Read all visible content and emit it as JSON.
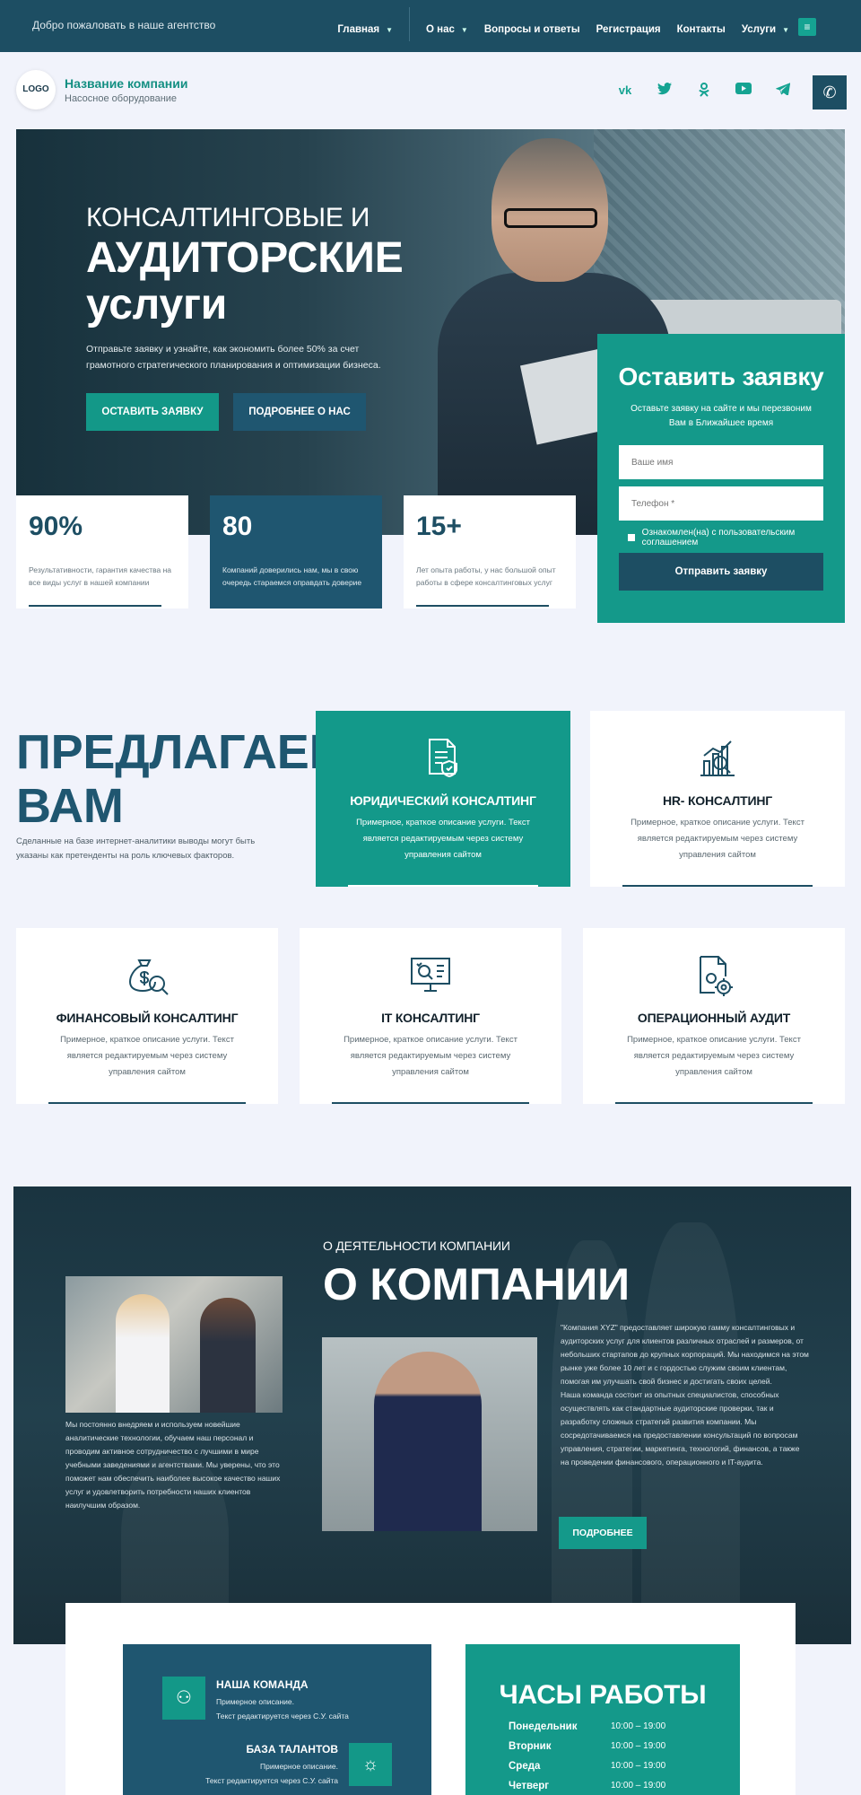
{
  "topbar": {
    "welcome": "Добро пожаловать в наше агентство",
    "nav": [
      {
        "label": "Главная",
        "dropdown": true
      },
      {
        "label": "О нас",
        "dropdown": true
      },
      {
        "label": "Вопросы и ответы",
        "dropdown": false
      },
      {
        "label": "Регистрация",
        "dropdown": false
      },
      {
        "label": "Контакты",
        "dropdown": false
      },
      {
        "label": "Услуги",
        "dropdown": true
      }
    ]
  },
  "header": {
    "logo": "LOGO",
    "company_name": "Название компании",
    "company_sub": "Насосное оборудование",
    "socials": [
      "vk-icon",
      "twitter-icon",
      "odnoklassniki-icon",
      "youtube-icon",
      "telegram-icon"
    ],
    "social_glyphs": [
      "vk",
      "🐦",
      "ꝋ",
      "▶",
      "➤"
    ]
  },
  "hero": {
    "title_line1": "КОНСАЛТИНГОВЫЕ И",
    "title_line2": "АУДИТОРСКИЕ услуги",
    "description": "Отправьте заявку и узнайте, как экономить более 50% за счет грамотного стратегического планирования и оптимизации бизнеса.",
    "btn_order": "ОСТАВИТЬ ЗАЯВКУ",
    "btn_more": "ПОДРОБНЕЕ О НАС"
  },
  "stats": [
    {
      "value": "90%",
      "text": "Результативности, гарантия качества на все виды услуг в нашей компании"
    },
    {
      "value": "80",
      "text": "Компаний доверились нам, мы в свою очередь стараемся оправдать доверие"
    },
    {
      "value": "15+",
      "text": "Лет опыта работы, у нас большой опыт работы в сфере консалтинговых услуг"
    }
  ],
  "form": {
    "title": "Оставить заявку",
    "subtitle": "Оставьте заявку на сайте и мы перезвоним Вам в Ближайшее время",
    "name_placeholder": "Ваше имя",
    "phone_placeholder": "Телефон *",
    "agree": "Ознакомлен(на) с пользовательским соглашением",
    "submit": "Отправить заявку"
  },
  "offer": {
    "title": "ПРЕДЛАГАЕМ ВАМ",
    "description": "Сделанные на базе интернет-аналитики выводы могут быть указаны как претенденты на роль ключевых факторов."
  },
  "services": [
    {
      "name": "ЮРИДИЧЕСКИЙ КОНСАЛТИНГ",
      "desc": "Примерное, краткое описание услуги. Текст является редактируемым через систему управления сайтом",
      "icon": "legal-document-icon"
    },
    {
      "name": "HR- КОНСАЛТИНГ",
      "desc": "Примерное, краткое описание услуги. Текст является редактируемым через систему управления сайтом",
      "icon": "hr-chart-icon"
    },
    {
      "name": "ФИНАНСОВЫЙ КОНСАЛТИНГ",
      "desc": "Примерное, краткое описание услуги. Текст является редактируемым через систему управления сайтом",
      "icon": "money-bag-icon"
    },
    {
      "name": "IT КОНСАЛТИНГ",
      "desc": "Примерное, краткое описание услуги. Текст является редактируемым через систему управления сайтом",
      "icon": "it-monitor-icon"
    },
    {
      "name": "ОПЕРАЦИОННЫЙ АУДИТ",
      "desc": "Примерное, краткое описание услуги. Текст является редактируемым через систему управления сайтом",
      "icon": "audit-gear-icon"
    }
  ],
  "about": {
    "pre": "О ДЕЯТЕЛЬНОСТИ КОМПАНИИ",
    "title": "О КОМПАНИИ",
    "left_text": "Мы постоянно внедряем и используем новейшие аналитические технологии, обучаем наш персонал и проводим активное сотрудничество с лучшими в мире учебными заведениями и агентствами. Мы уверены, что это поможет нам обеспечить наиболее высокое качество наших услуг и удовлетворить потребности наших клиентов наилучшим образом.",
    "right_text_1": "\"Компания XYZ\" предоставляет широкую гамму консалтинговых и аудиторских услуг для клиентов различных отраслей и размеров, от небольших стартапов до крупных корпораций. Мы находимся на этом рынке уже более 10 лет и с гордостью служим своим клиентам, помогая им улучшать свой бизнес и достигать своих целей.",
    "right_text_2": "Наша команда состоит из опытных специалистов, способных осуществлять как стандартные аудиторские проверки, так и разработку сложных стратегий развития компании. Мы сосредотачиваемся на предоставлении консультаций по вопросам управления, стратегии, маркетинга, технологий, финансов, а также на проведении финансового, операционного и IT-аудита.",
    "btn": "ПОДРОБНЕЕ"
  },
  "team": [
    {
      "title": "НАША КОМАНДА",
      "line1": "Примерное описание.",
      "line2": "Текст редактируется через С.У. сайта"
    },
    {
      "title": "БАЗА ТАЛАНТОВ",
      "line1": "Примерное описание.",
      "line2": "Текст редактируется через С.У. сайта"
    }
  ],
  "hours": {
    "title": "ЧАСЫ РАБОТЫ",
    "rows": [
      {
        "day": "Понедельник",
        "time": "10:00 – 19:00"
      },
      {
        "day": "Вторник",
        "time": "10:00 – 19:00"
      },
      {
        "day": "Среда",
        "time": "10:00 – 19:00"
      },
      {
        "day": "Четверг",
        "time": "10:00 – 19:00"
      }
    ]
  },
  "colors": {
    "primary": "#1d4e63",
    "accent": "#13998a",
    "background": "#f1f3fb"
  }
}
